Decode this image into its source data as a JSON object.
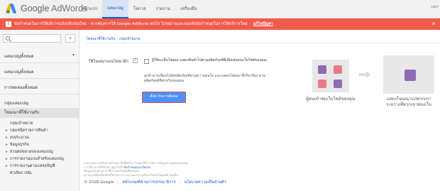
{
  "header": {
    "logo_brand": "Google",
    "logo_product": "AdWords",
    "nav": [
      "หน้าแรก",
      "แคมเปญ",
      "โอกาส",
      "รายงาน",
      "เครื่องมือ"
    ],
    "active_nav": "แคมเปญ",
    "customer": "cam"
  },
  "banner": {
    "text": "ข้อกำหนดในการให้บริการฉบับปรับปรุงใหม่ - หากต้องการใช้ Google AdWords ต่อไป โปรดอ่านและยอมรับข้อกำหนดในการให้บริการใหม่",
    "link": "แก้ไขปัญหา",
    "color": "#f15b4b"
  },
  "sidebar": {
    "items": [
      {
        "label": "แคมเปญทั้งหมด"
      },
      {
        "label": "แคมเปญทั้งหมด"
      },
      {
        "label": "การทดลองทั้งหมด"
      },
      {
        "label": "กลุ่มแคมเปญ"
      },
      {
        "label": "โฆษณาที่ใช้งานกับ"
      }
    ],
    "subitems": [
      {
        "label": "กลุ่มเป้าหมาย",
        "arrow": false
      },
      {
        "label": "กลุ่มชนิดรายการสินค้า",
        "arrow": true
      },
      {
        "label": "งบประมาณ",
        "arrow": true
      },
      {
        "label": "ข้อมูลธุรกิจ",
        "arrow": true
      },
      {
        "label": "ส่วนต่อขยายของแคมเปญ",
        "arrow": true
      },
      {
        "label": "การรายงานแบบสำหรับแคมเปญ",
        "arrow": true
      },
      {
        "label": "การรายงานตามแหล่งบัญชี",
        "arrow": true
      },
      {
        "label": "ตัวเลือก URL",
        "arrow": false
      }
    ]
  },
  "main": {
    "breadcrumb": [
      "โฆษณาที่ใช้งานกับ",
      "กลุ่มเป้าหมาย"
    ],
    "ad_label": "ใช้โฆษณาแบบไดนามิก",
    "help": "?",
    "checkbox_text": "ผู้ใช้จะเห็นโฆษณาแสดงสินค้าไปตามผลิตภัณฑ์ที่เยี่ยมชมบนเว็บไซต์ของคุณ",
    "note": "ลูกค้าอาจเลื่อนไปยังผลิตภัณฑ์ตามความสนใจ และแสดงโฆษณาที่เกี่ยวข้อง ตามผลิตภัณฑ์ที่ตรงกันของคุณ",
    "button": "ตั้งค่ากับการติดต่อ"
  },
  "illustration": {
    "caption_left": "ผู้คนเข้าชมเว็บไซต์ของคุณ",
    "caption_right": "แสดงโฆษณาแก่พวกเขา ระหว่างที่พวกเขาท่องเว็บ"
  },
  "fine_print": {
    "line1": "นโยบายความเป็นส่วนตัวของ AdWords กำหนดวิธีการจัดการข้อมูลส่วนบุคคลของคุณ",
    "line2": "การใช้งาน AdWords อยู่ภายใต้",
    "link": "ข้อกำหนดและเงื่อนไข",
    "line3": "ข้อมูลแสดงตามเวลาที่กำหนดในบัญชีของคุณ",
    "line4": "ดูรายละเอียดเพิ่มเติมเกี่ยวกับการรายงานและการเรียกเก็บเงินในศูนย์ช่วยเหลือ"
  },
  "footer": {
    "copyright": "© 2018 Google",
    "link1": "หลักเกณฑ์ด้านการบรรณาธิการ",
    "link2": "นโยบายความเป็นส่วนตัว"
  }
}
